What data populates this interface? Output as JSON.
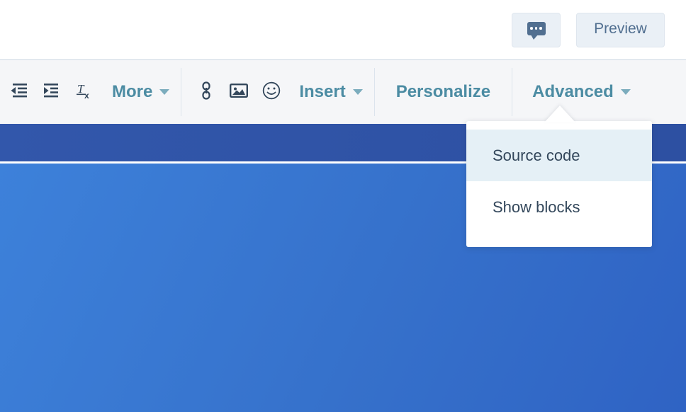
{
  "topbar": {
    "comment_button": {
      "icon": "comment-bubble-icon",
      "label": ""
    },
    "preview_button": {
      "label": "Preview"
    }
  },
  "toolbar": {
    "groups": [
      {
        "items": [
          {
            "name": "outdent-icon",
            "type": "icon",
            "label": ""
          },
          {
            "name": "indent-icon",
            "type": "icon",
            "label": ""
          },
          {
            "name": "clear-formatting-icon",
            "type": "icon",
            "label": ""
          },
          {
            "name": "more-dropdown",
            "type": "text",
            "label": "More",
            "caret": true
          }
        ]
      },
      {
        "items": [
          {
            "name": "link-icon",
            "type": "icon",
            "label": ""
          },
          {
            "name": "image-icon",
            "type": "icon",
            "label": ""
          },
          {
            "name": "emoji-icon",
            "type": "icon",
            "label": ""
          },
          {
            "name": "insert-dropdown",
            "type": "text",
            "label": "Insert",
            "caret": true
          }
        ]
      },
      {
        "items": [
          {
            "name": "personalize-button",
            "type": "text",
            "label": "Personalize",
            "caret": false
          }
        ]
      },
      {
        "items": [
          {
            "name": "advanced-dropdown",
            "type": "text",
            "label": "Advanced",
            "caret": true
          }
        ]
      }
    ]
  },
  "advanced_menu": {
    "open": true,
    "items": [
      {
        "label": "Source code",
        "highlighted": true
      },
      {
        "label": "Show blocks",
        "highlighted": false
      }
    ]
  },
  "canvas": {
    "bands": [
      {
        "name": "header-band-dark",
        "color": "#3257ab"
      },
      {
        "name": "body-band-light",
        "color": "#3671cb"
      }
    ]
  },
  "colors": {
    "toolbar_link": "#4c8ca3",
    "toolbar_bg": "#f5f6f8",
    "button_text": "#516f90",
    "button_bg": "#eaf0f6",
    "menu_text": "#33475b",
    "menu_highlight": "#e5f0f6",
    "band_dark": "#3257ab",
    "band_light": "#3671cb",
    "border": "#cbd6e2"
  }
}
